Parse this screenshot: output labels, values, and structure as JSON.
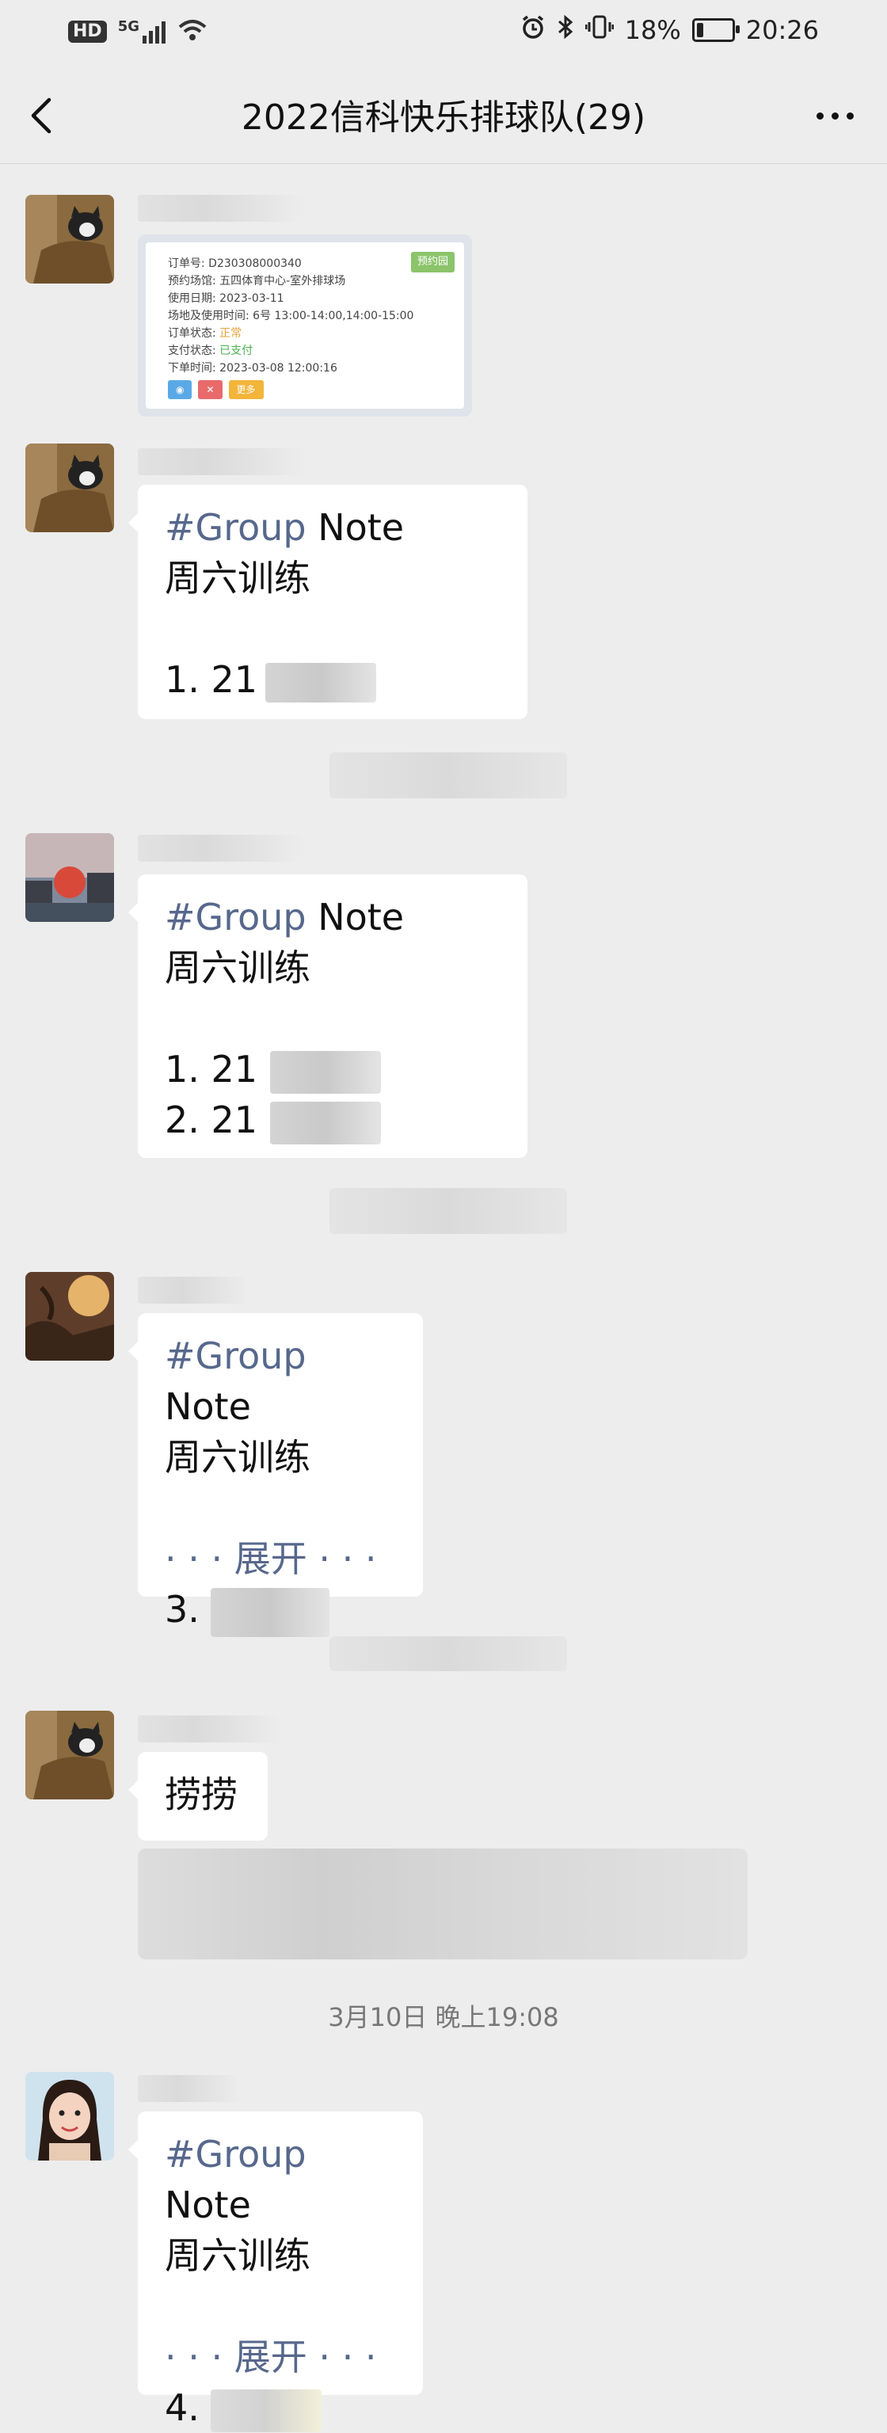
{
  "status_bar": {
    "hd_label": "HD",
    "network": "5G",
    "battery_percent": "18%",
    "battery_level": 0.18,
    "time": "20:26"
  },
  "nav": {
    "title": "2022信科快乐排球队(29)"
  },
  "order_card": {
    "order_no": "订单号: D230308000340",
    "badge": "预约园",
    "venue": "预约场馆: 五四体育中心-室外排球场",
    "date": "使用日期: 2023-03-11",
    "slot": "场地及使用时间: 6号 13:00-14:00,14:00-15:00",
    "order_status_label": "订单状态: ",
    "order_status": "正常",
    "pay_status_label": "支付状态: ",
    "pay_status": "已支付",
    "placed": "下单时间: 2023-03-08 12:00:16",
    "btn_view": "◉",
    "btn_cancel": "✕",
    "btn_more": "更多"
  },
  "messages": [
    {
      "tag": "#Group",
      "word": " Note",
      "title": "周六训练",
      "lines": [
        "1. 21"
      ]
    },
    {
      "tag": "#Group",
      "word": " Note",
      "title": "周六训练",
      "lines": [
        "1. 21",
        "2. 21"
      ]
    },
    {
      "tag": "#Group",
      "word": " Note",
      "title": "周六训练",
      "expand": "· · · 展开 · · ·",
      "lines": [
        "3."
      ]
    },
    {
      "text": "捞捞"
    },
    {
      "tag": "#Group",
      "word": " Note",
      "title": "周六训练",
      "expand": "· · · 展开 · · ·",
      "lines": [
        "4."
      ]
    }
  ],
  "timestamp": "3月10日 晚上19:08"
}
